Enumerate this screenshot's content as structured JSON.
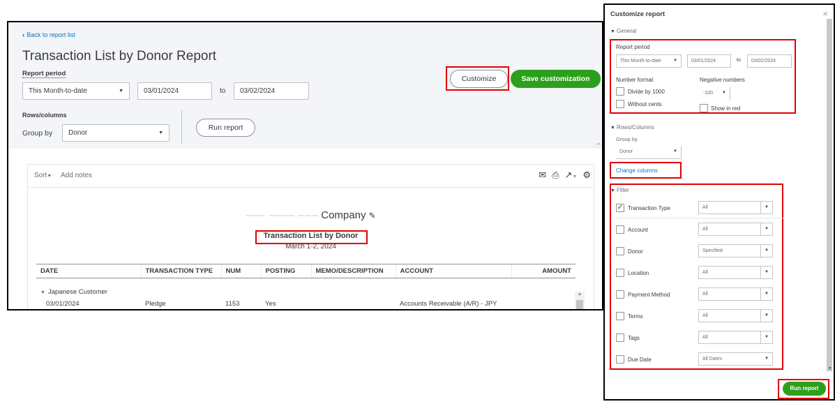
{
  "left": {
    "back_link": "Back to report list",
    "page_title": "Transaction List by Donor Report",
    "report_period_label": "Report period",
    "period_select": "This Month-to-date",
    "date_from": "03/01/2024",
    "to_label": "to",
    "date_to": "03/02/2024",
    "rows_columns_label": "Rows/columns",
    "group_by_label": "Group by",
    "group_by_value": "Donor",
    "run_report": "Run report",
    "customize": "Customize",
    "save_customization": "Save customization",
    "report": {
      "sort_label": "Sort",
      "add_notes": "Add notes",
      "company_redacted": "––– –––– –––",
      "company_visible": "Company",
      "title": "Transaction List by Donor",
      "subtitle": "March 1-2, 2024",
      "columns": [
        "DATE",
        "TRANSACTION TYPE",
        "NUM",
        "POSTING",
        "MEMO/DESCRIPTION",
        "ACCOUNT",
        "AMOUNT"
      ],
      "group_name": "Japanese Customer",
      "rows": [
        {
          "date": "03/01/2024",
          "type": "Pledge",
          "num": "1153",
          "posting": "Yes",
          "memo": "",
          "account": "Accounts Receivable (A/R) - JPY",
          "amount": ""
        }
      ]
    }
  },
  "panel": {
    "title": "Customize report",
    "general": {
      "header": "General",
      "report_period_label": "Report period",
      "period_select": "This Month-to-date",
      "date_from": "03/01/2024",
      "to_label": "to",
      "date_to": "03/02/2024",
      "number_format_label": "Number format",
      "divide_by_1000": "Divide by 1000",
      "without_cents": "Without cents",
      "negative_numbers_label": "Negative numbers",
      "negative_value": "-100",
      "show_in_red": "Show in red"
    },
    "rows_columns": {
      "header": "Rows/Columns",
      "group_by_label": "Group by",
      "group_by_value": "Donor",
      "change_columns": "Change columns"
    },
    "filter": {
      "header": "Filter",
      "items": [
        {
          "label": "Transaction Type",
          "value": "All",
          "checked": true
        },
        {
          "label": "Account",
          "value": "All",
          "checked": false
        },
        {
          "label": "Donor",
          "value": "Specified",
          "checked": false
        },
        {
          "label": "Location",
          "value": "All",
          "checked": false
        },
        {
          "label": "Payment Method",
          "value": "All",
          "checked": false
        },
        {
          "label": "Terms",
          "value": "All",
          "checked": false
        },
        {
          "label": "Tags",
          "value": "All",
          "checked": false
        },
        {
          "label": "Due Date",
          "value": "All Dates",
          "checked": false
        }
      ]
    },
    "run_report": "Run report"
  },
  "colors": {
    "accent_green": "#2ca01c",
    "link_blue": "#0077c5",
    "highlight_red": "#e00000"
  }
}
